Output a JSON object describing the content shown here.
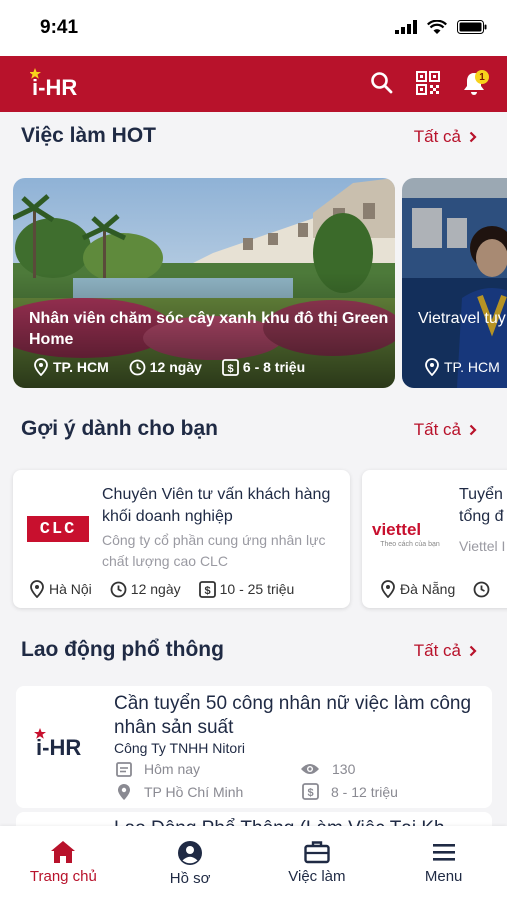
{
  "status_bar": {
    "time": "9:41"
  },
  "app": {
    "logo_text": "i-HR",
    "notification_count": "1",
    "brand_color": "#b8122b"
  },
  "hot": {
    "title": "Việc làm HOT",
    "see_all": "Tất cả",
    "cards": [
      {
        "title": "Nhân viên chăm sóc cây xanh khu đô thị Green Home",
        "location": "TP. HCM",
        "days": "12 ngày",
        "salary": "6 - 8 triệu"
      },
      {
        "title": "Vietravel tuy thông",
        "location": "TP. HCM"
      }
    ]
  },
  "suggest": {
    "title": "Gợi ý dành cho bạn",
    "see_all": "Tất cả",
    "cards": [
      {
        "logo": "CLC",
        "title": "Chuyên Viên tư vấn khách hàng khối doanh nghiệp",
        "company": "Công ty cổ phần cung ứng nhân lực chất lượng cao CLC",
        "location": "Hà Nội",
        "days": "12 ngày",
        "salary": "10 - 25 triệu"
      },
      {
        "logo": "viettel",
        "logo_sub": "Theo cách của bạn",
        "title": "Tuyển tổng đ",
        "company": "Viettel I",
        "location": "Đà Nẵng"
      }
    ]
  },
  "labor": {
    "title": "Lao động phổ thông",
    "see_all": "Tất cả",
    "card": {
      "logo": "i-HR",
      "title": "Cần tuyển 50 công nhân nữ việc làm công nhân sản suất",
      "company": "Công Ty TNHH Nitori",
      "posted": "Hôm nay",
      "views": "130",
      "location": "TP Hồ Chí Minh",
      "salary": "8 - 12 triệu"
    },
    "next_card_title": "Lao Động Phổ Thông (Làm Việc Tại Kh"
  },
  "bottom_nav": [
    {
      "label": "Trang chủ",
      "icon": "home-icon"
    },
    {
      "label": "Hồ sơ",
      "icon": "profile-icon"
    },
    {
      "label": "Việc làm",
      "icon": "briefcase-icon"
    },
    {
      "label": "Menu",
      "icon": "menu-icon"
    }
  ]
}
